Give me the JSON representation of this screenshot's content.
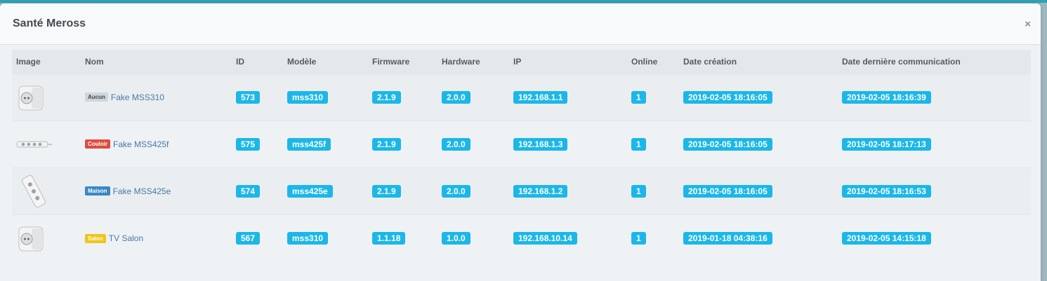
{
  "modal": {
    "title": "Santé Meross",
    "close_glyph": "×"
  },
  "table": {
    "headers": {
      "image": "Image",
      "name": "Nom",
      "id": "ID",
      "model": "Modèle",
      "firmware": "Firmware",
      "hardware": "Hardware",
      "ip": "IP",
      "online": "Online",
      "created": "Date création",
      "last_comm": "Date dernière communication"
    },
    "rows": [
      {
        "image": "plug-icon",
        "room": "Aucun",
        "room_color": "#cfd6dd",
        "room_text_color": "#444444",
        "name": "Fake MSS310",
        "id": "573",
        "model": "mss310",
        "firmware": "2.1.9",
        "hardware": "2.0.0",
        "ip": "192.168.1.1",
        "online": "1",
        "created": "2019-02-05 18:16:05",
        "last_comm": "2019-02-05 18:16:39"
      },
      {
        "image": "power-strip-icon",
        "room": "Couloir",
        "room_color": "#e04b3f",
        "room_text_color": "#ffffff",
        "name": "Fake MSS425f",
        "id": "575",
        "model": "mss425f",
        "firmware": "2.1.9",
        "hardware": "2.0.0",
        "ip": "192.168.1.3",
        "online": "1",
        "created": "2019-02-05 18:16:05",
        "last_comm": "2019-02-05 18:17:13"
      },
      {
        "image": "power-strip-angled-icon",
        "room": "Maison",
        "room_color": "#3a87c6",
        "room_text_color": "#ffffff",
        "name": "Fake MSS425e",
        "id": "574",
        "model": "mss425e",
        "firmware": "2.1.9",
        "hardware": "2.0.0",
        "ip": "192.168.1.2",
        "online": "1",
        "created": "2019-02-05 18:16:05",
        "last_comm": "2019-02-05 18:16:53"
      },
      {
        "image": "plug-icon",
        "room": "Salon",
        "room_color": "#f0c419",
        "room_text_color": "#ffffff",
        "name": "TV Salon",
        "id": "567",
        "model": "mss310",
        "firmware": "1.1.18",
        "hardware": "1.0.0",
        "ip": "192.168.10.14",
        "online": "1",
        "created": "2019-01-18 04:38:16",
        "last_comm": "2019-02-05 14:15:18"
      }
    ]
  },
  "colors": {
    "label_bg": "#1cb7e8",
    "accent": "#2aa5b8"
  }
}
